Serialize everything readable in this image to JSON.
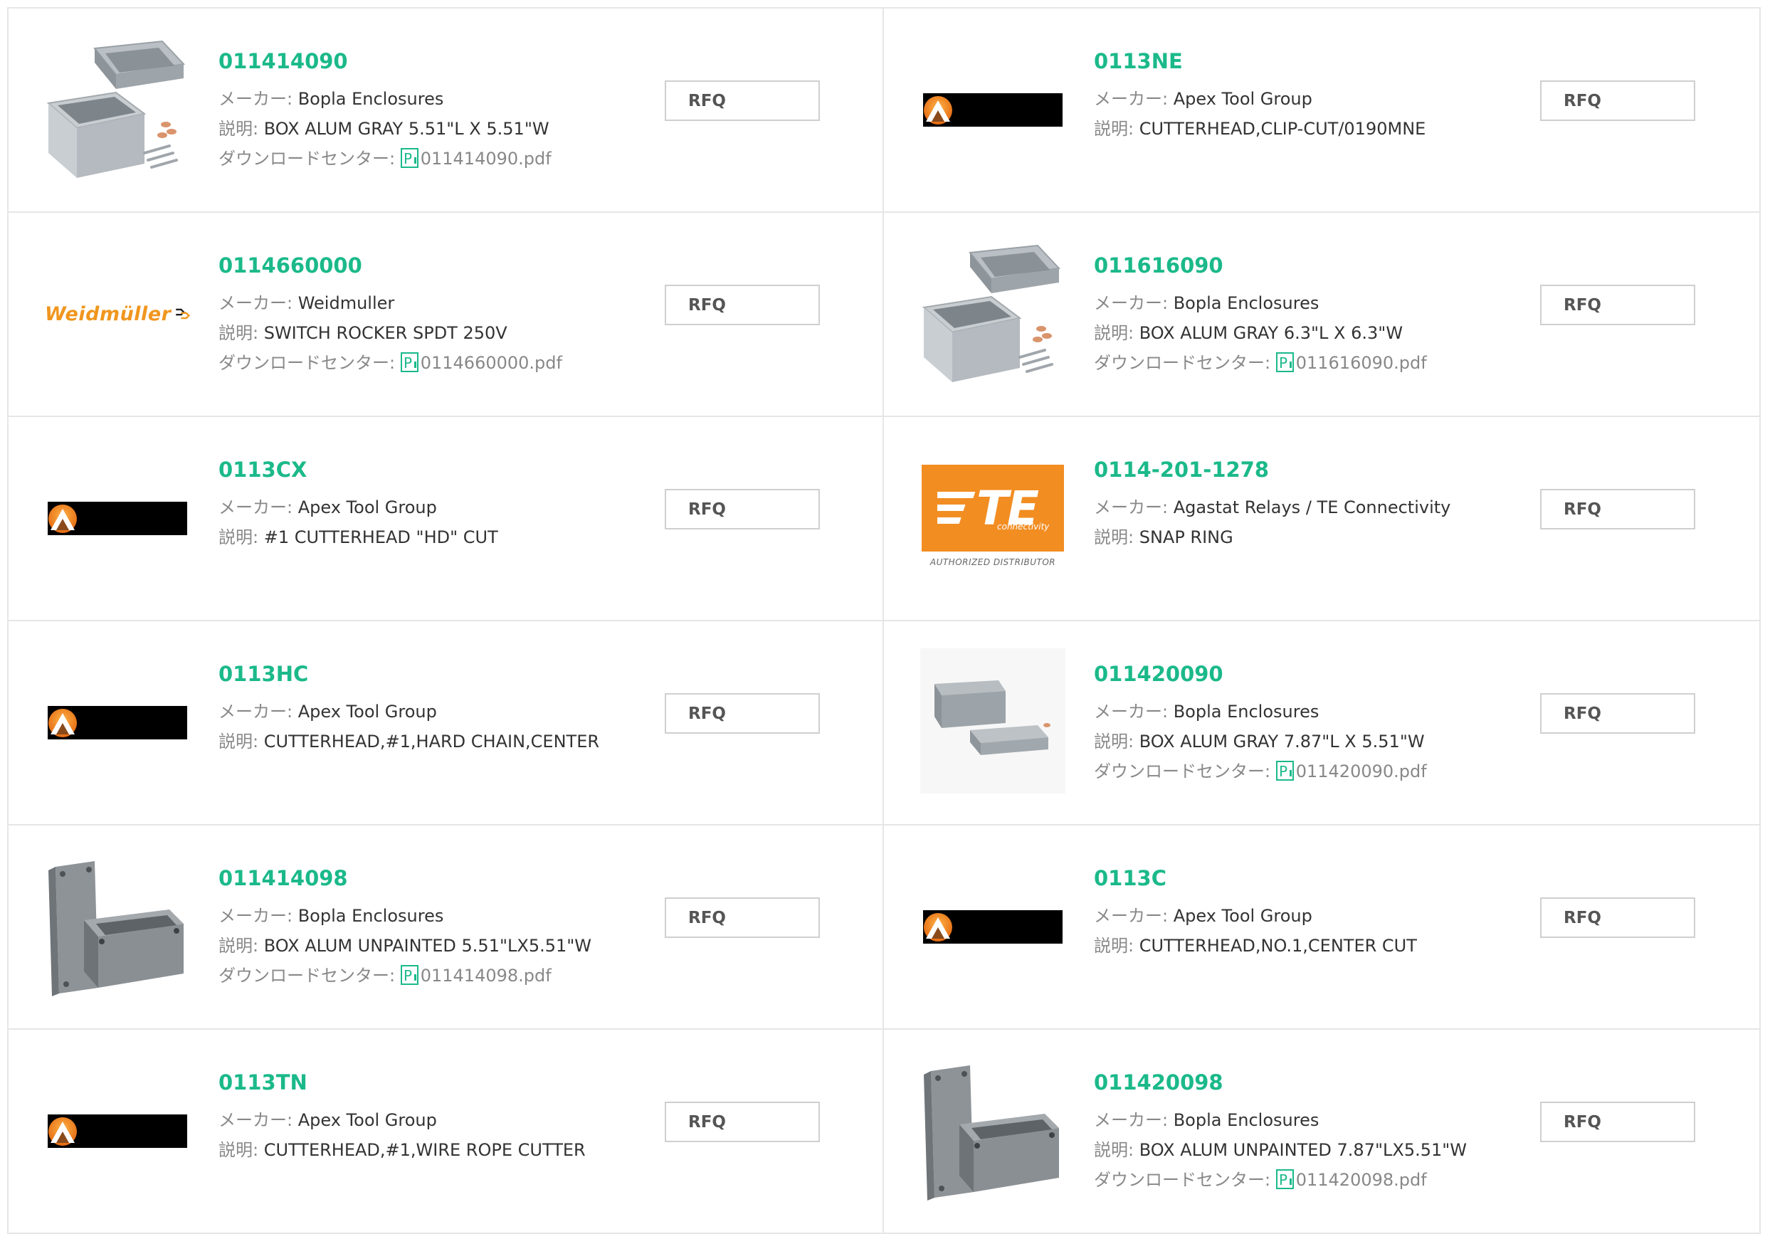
{
  "labels": {
    "maker": "メーカー: ",
    "desc": "説明: ",
    "download": "ダウンロードセンター: ",
    "rfq": "RFQ"
  },
  "colors": {
    "part_number": "#1bb98a",
    "label": "#888888",
    "border": "#e6e6e6",
    "te_orange": "#f28d22",
    "weidmuller_orange": "#f0961e"
  },
  "products": [
    {
      "pn": "011414090",
      "maker": "Bopla Enclosures",
      "desc": "BOX ALUM GRAY 5.51\"L X 5.51\"W",
      "pdf": "011414090.pdf",
      "image": "enclosure-gray-open-icon"
    },
    {
      "pn": "0113NE",
      "maker": "Apex Tool Group",
      "desc": "CUTTERHEAD,CLIP-CUT/0190MNE",
      "image": "apex-tool-group-logo"
    },
    {
      "pn": "0114660000",
      "maker": "Weidmuller",
      "desc": "SWITCH ROCKER SPDT 250V",
      "pdf": "0114660000.pdf",
      "image": "weidmuller-logo",
      "brand_text": "Weidmüller"
    },
    {
      "pn": "011616090",
      "maker": "Bopla Enclosures",
      "desc": "BOX ALUM GRAY 6.3\"L X 6.3\"W",
      "pdf": "011616090.pdf",
      "image": "enclosure-gray-open-icon"
    },
    {
      "pn": "0113CX",
      "maker": "Apex Tool Group",
      "desc": "#1 CUTTERHEAD \"HD\" CUT",
      "image": "apex-tool-group-logo"
    },
    {
      "pn": "0114-201-1278",
      "maker": "Agastat Relays / TE Connectivity",
      "desc": "SNAP RING",
      "image": "te-connectivity-logo",
      "brand_text": "TE",
      "brand_sub": "connectivity",
      "brand_note": "AUTHORIZED DISTRIBUTOR"
    },
    {
      "pn": "0113HC",
      "maker": "Apex Tool Group",
      "desc": "CUTTERHEAD,#1,HARD CHAIN,CENTER",
      "image": "apex-tool-group-logo"
    },
    {
      "pn": "011420090",
      "maker": "Bopla Enclosures",
      "desc": "BOX ALUM GRAY 7.87\"L X 5.51\"W",
      "pdf": "011420090.pdf",
      "image": "enclosure-gray-flat-icon"
    },
    {
      "pn": "011414098",
      "maker": "Bopla Enclosures",
      "desc": "BOX ALUM UNPAINTED 5.51\"LX5.51\"W",
      "pdf": "011414098.pdf",
      "image": "enclosure-unpainted-icon"
    },
    {
      "pn": "0113C",
      "maker": "Apex Tool Group",
      "desc": "CUTTERHEAD,NO.1,CENTER CUT",
      "image": "apex-tool-group-logo"
    },
    {
      "pn": "0113TN",
      "maker": "Apex Tool Group",
      "desc": "CUTTERHEAD,#1,WIRE ROPE CUTTER",
      "image": "apex-tool-group-logo"
    },
    {
      "pn": "011420098",
      "maker": "Bopla Enclosures",
      "desc": "BOX ALUM UNPAINTED 7.87\"LX5.51\"W",
      "pdf": "011420098.pdf",
      "image": "enclosure-unpainted-icon"
    }
  ]
}
